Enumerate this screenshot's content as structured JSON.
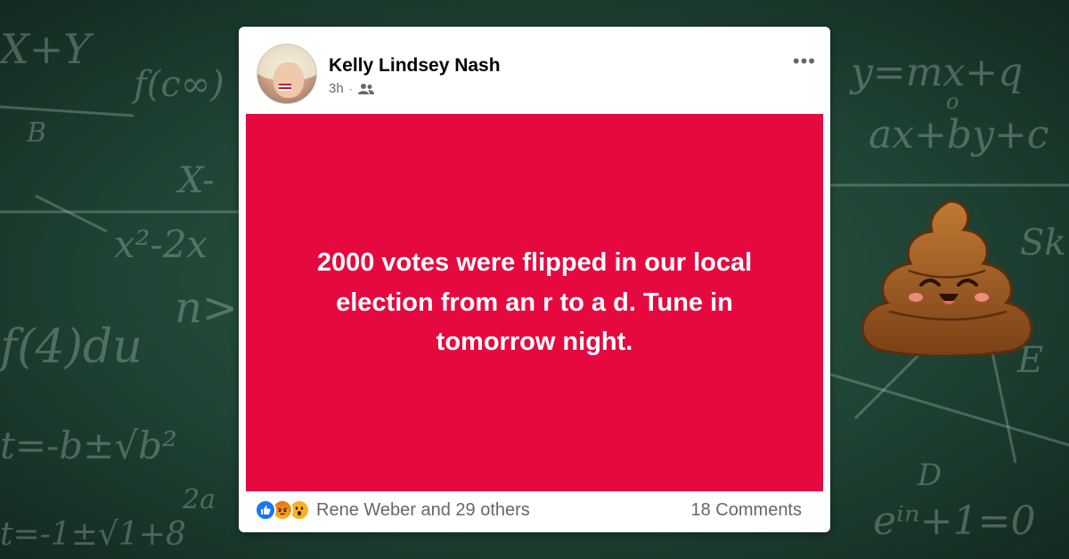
{
  "background": {
    "chalk_formulas": [
      "X+Y",
      "f(c∞)",
      "B",
      "X-",
      "x²-2x",
      "n>",
      "f(4)du",
      "t=-b±√b²",
      "2a",
      "t=-1±√1+8",
      "y=mx+q",
      "o",
      "ax+by+c",
      "Sk",
      "E",
      "D",
      "eⁱⁿ+1=0"
    ],
    "color": "#1f4334"
  },
  "post": {
    "author": "Kelly Lindsey Nash",
    "time": "3h",
    "separator": "·",
    "audience_icon": "friends-icon",
    "more_label": "•••",
    "text": "2000 votes were flipped in our local election from an r to a d. Tune in tomorrow night.",
    "panel_color": "#e5093f",
    "reaction_icons": [
      "like-icon",
      "angry-icon",
      "wow-icon"
    ],
    "reactions_summary": "Rene Weber and 29 others",
    "comments": "18 Comments"
  },
  "sticker": "poop-emoji-icon"
}
